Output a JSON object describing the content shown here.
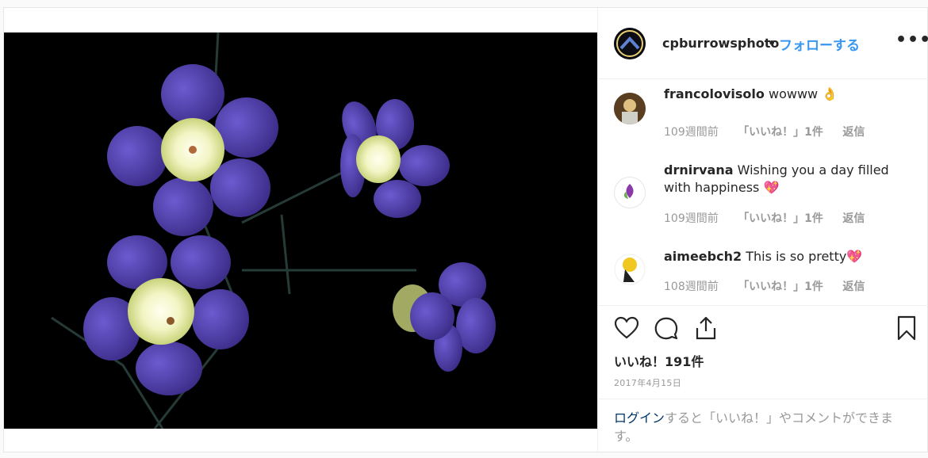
{
  "post": {
    "owner": {
      "username": "cpburrowsphoto",
      "separator": "•",
      "follow_label": "フォローする"
    },
    "more_label": "•••",
    "comments": [
      {
        "user": "francolovisolo",
        "text": "wowww 👌",
        "time": "109週間前",
        "likes": "「いいね！」1件",
        "reply": "返信"
      },
      {
        "user": "drnirvana",
        "text": "Wishing you a day filled with happiness 💖",
        "time": "109週間前",
        "likes": "「いいね！」1件",
        "reply": "返信"
      },
      {
        "user": "aimeebch2",
        "text": "This is so pretty💖",
        "time": "108週間前",
        "likes": "「いいね！」1件",
        "reply": "返信"
      }
    ],
    "like_count": "いいね！191件",
    "date": "2017年4月15日",
    "login_link": "ログイン",
    "login_text": "すると「いいね！」やコメントができます。"
  },
  "icons": [
    "heart-icon",
    "comment-icon",
    "share-icon",
    "bookmark-icon",
    "more-icon"
  ],
  "colors": {
    "accent": "#3897f0",
    "petal": "#4b3a9e",
    "text_muted": "#999999"
  }
}
